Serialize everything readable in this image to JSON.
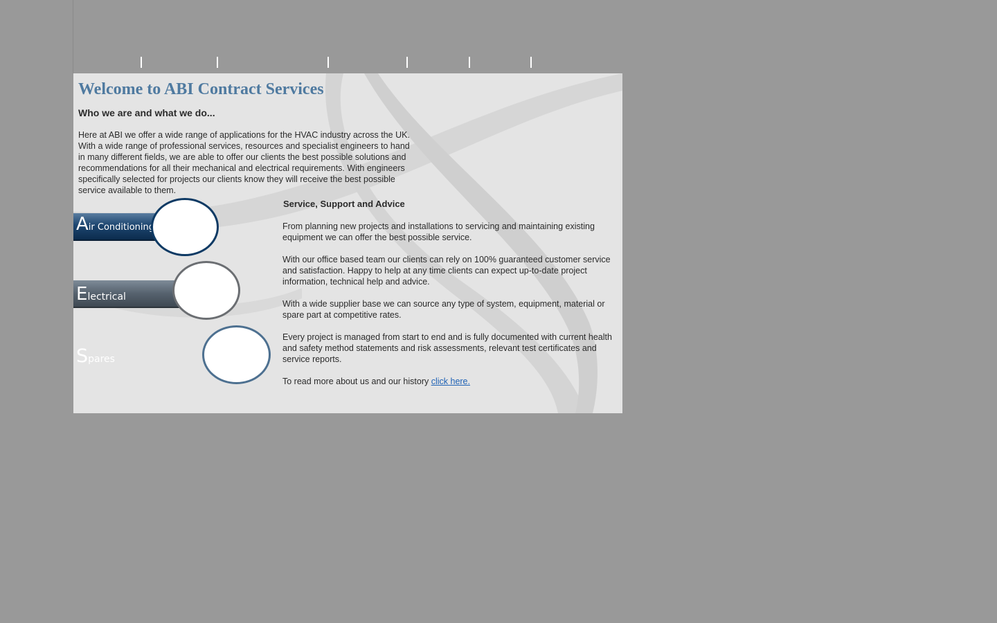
{
  "page": {
    "title": "Welcome to ABI Contract Services",
    "subheading": "Who we are and what we do...",
    "intro": "Here at ABI we offer a wide range of applications for the HVAC industry across the UK. With a wide range of professional services, resources and specialist engineers to hand in many different fields, we are able to offer our clients the best possible solutions and recommendations for all their mechanical and electrical requirements. With engineers specifically selected for projects our clients know they will receive the best possible service available to them."
  },
  "services": {
    "air_conditioning": {
      "initial": "A",
      "rest": "ir Conditioning"
    },
    "electrical": {
      "initial": "E",
      "rest": "lectrical"
    },
    "spares": {
      "initial": "S",
      "rest": "pares"
    }
  },
  "support": {
    "title": "Service, Support and Advice",
    "p1": "From planning new projects and installations to servicing and maintaining existing equipment we can offer the best possible service.",
    "p2": "With our office based team our clients can rely on 100% guaranteed customer service  and satisfaction. Happy to help at any time clients can expect up-to-date project information, technical help and advice.",
    "p3": "With a wide supplier base we can source any type of system, equipment, material or spare part at competitive rates.",
    "p4": "Every project is managed from start to end and is fully documented with current health and safety method statements and risk assessments, relevant test certificates and service reports.",
    "read_more": "To read more about us and our history ",
    "link_text": "click here."
  },
  "colors": {
    "page_bg": "#999999",
    "panel_bg": "#e4e4e4",
    "title": "#4f7aa0",
    "link": "#1f62b5",
    "ac_bar": "#1d4670",
    "electrical_bar": "#56626e"
  }
}
